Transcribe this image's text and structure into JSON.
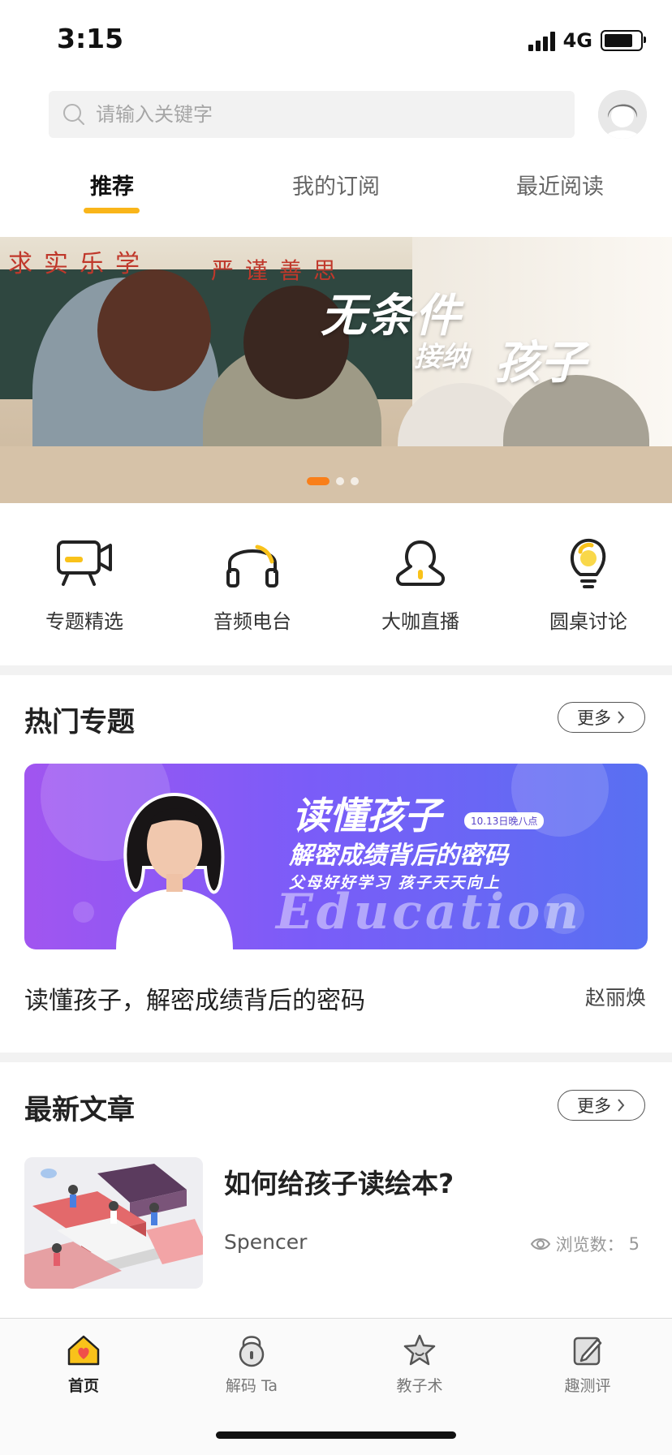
{
  "status_bar": {
    "time": "3:15",
    "network": "4G"
  },
  "search": {
    "placeholder": "请输入关键字"
  },
  "tabs": [
    {
      "label": "推荐",
      "active": true
    },
    {
      "label": "我的订阅",
      "active": false
    },
    {
      "label": "最近阅读",
      "active": false
    }
  ],
  "banner": {
    "headline_1": "无条件",
    "headline_2": "接纳",
    "headline_3": "孩子",
    "wall_slogan": "求实乐学",
    "wall_motto": "严谨善思",
    "page_count": 3,
    "active_page": 1
  },
  "quick_links": [
    {
      "label": "专题精选",
      "icon": "video-camera-icon"
    },
    {
      "label": "音频电台",
      "icon": "headphones-icon"
    },
    {
      "label": "大咖直播",
      "icon": "person-icon"
    },
    {
      "label": "圆桌讨论",
      "icon": "lightbulb-icon"
    }
  ],
  "hot_topics": {
    "title": "热门专题",
    "more_label": "更多",
    "card": {
      "headline": "读懂孩子",
      "date_tag": "10.13日晚八点",
      "subheadline": "解密成绩背后的密码",
      "tagline": "父母好好学习 孩子天天向上",
      "watermark": "Education"
    },
    "item_title": "读懂孩子，解密成绩背后的密码",
    "item_author": "赵丽焕"
  },
  "latest_articles": {
    "title": "最新文章",
    "more_label": "更多",
    "items": [
      {
        "title": "如何给孩子读绘本?",
        "author": "Spencer",
        "views_label": "浏览数：",
        "views": "5"
      }
    ]
  },
  "tab_bar": [
    {
      "label": "首页",
      "icon": "home-icon",
      "active": true
    },
    {
      "label": "解码 Ta",
      "icon": "lock-icon",
      "active": false
    },
    {
      "label": "教子术",
      "icon": "star-icon",
      "active": false
    },
    {
      "label": "趣测评",
      "icon": "edit-icon",
      "active": false
    }
  ],
  "colors": {
    "accent": "#f9b51a",
    "banner_dot_active": "#f97f1a",
    "topic_gradient_start": "#a155f0",
    "topic_gradient_end": "#5870f2"
  }
}
